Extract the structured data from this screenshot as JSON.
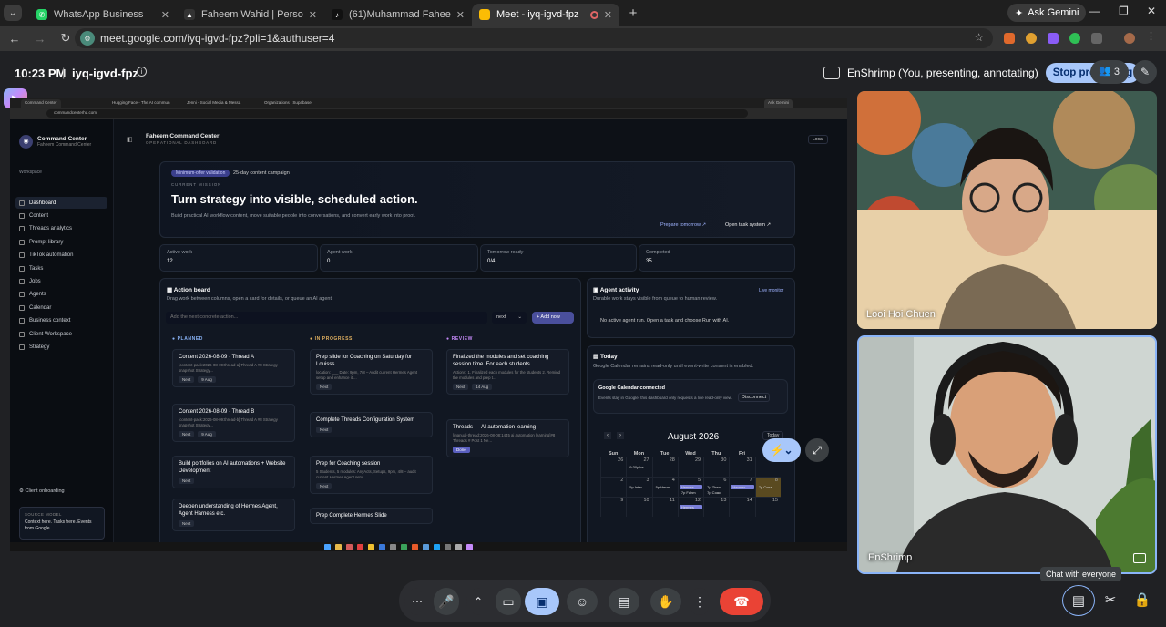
{
  "browser": {
    "tabs": [
      {
        "title": "WhatsApp Business",
        "icon": "whatsapp-icon",
        "color": "#25d366"
      },
      {
        "title": "Faheem Wahid | Personal link d",
        "icon": "threads-icon",
        "color": "#333333"
      },
      {
        "title": "(61)Muhammad Faheem (@_fa",
        "icon": "tiktok-icon",
        "color": "#111111"
      },
      {
        "title": "Meet - iyq-igvd-fpz",
        "icon": "meet-icon",
        "color": "#fbbc04"
      }
    ],
    "gemini_label": "Ask Gemini",
    "url": "meet.google.com/iyq-igvd-fpz?pli=1&authuser=4"
  },
  "meet": {
    "time": "10:23 PM",
    "code": "iyq-igvd-fpz",
    "presenting_label": "EnShrimp (You, presenting, annotating)",
    "stop_label": "Stop presenting",
    "people_count": "3",
    "tooltip": "Chat with everyone"
  },
  "shared": {
    "sh_tabs": [
      "Command Center",
      "Hugging Face - The AI commun",
      "Jenni - Social Media & Messa",
      "Organizations | Supabase"
    ],
    "sh_gemini": "Ask Gemini",
    "sh_url": "commandcenterhq.com",
    "brand_title": "Command Center",
    "brand_sub": "Faheem Command Center",
    "ws_label": "Workspace",
    "nav": [
      "Dashboard",
      "Content",
      "Threads analytics",
      "Prompt library",
      "TikTok automation",
      "Tasks",
      "Jobs",
      "Agents",
      "Calendar",
      "Business context",
      "Client Workspace",
      "Strategy"
    ],
    "onboarding": "Client onboarding",
    "share_title": "SOURCE MODEL",
    "share_text": "Context here. Tasks here. Events from Google.",
    "head_title": "Faheem Command Center",
    "head_sub": "OPERATIONAL DASHBOARD",
    "local": "Local",
    "hero": {
      "pill": "Minimum-offer validation",
      "pill2": "25-day content campaign",
      "mission": "CURRENT MISSION",
      "title": "Turn strategy into visible, scheduled action.",
      "desc": "Build practical AI workflow content, move suitable people into conversations, and convert early work into proof.",
      "link1": "Prepare tomorrow ↗",
      "link2": "Open task system ↗"
    },
    "stats": [
      {
        "label": "Active work",
        "value": "12"
      },
      {
        "label": "Agent work",
        "value": "0"
      },
      {
        "label": "Tomorrow ready",
        "value": "0/4"
      },
      {
        "label": "Completed",
        "value": "35"
      }
    ],
    "board": {
      "title": "Action board",
      "sub": "Drag work between columns, open a card for details, or queue an AI agent.",
      "placeholder": "Add the next concrete action...",
      "select": "next",
      "add": "+ Add now",
      "columns": [
        "PLANNED",
        "IN PROGRESS",
        "REVIEW"
      ],
      "planned": [
        {
          "t": "Content 2026-08-09 · Thread A",
          "d": "[content-pack:2026-08-09:thread-a] Thread A #8 Strategy snapshot Strategy...",
          "tags": [
            "Next",
            "9 Aug"
          ]
        },
        {
          "t": "Content 2026-08-09 · Thread B",
          "d": "[content-pack:2026-08-09:thread-b] Thread A #8 Strategy snapshot Strategy...",
          "tags": [
            "Next",
            "9 Aug"
          ]
        },
        {
          "t": "Build portfolios on AI automations + Website Development",
          "d": "",
          "tags": [
            "Next"
          ]
        },
        {
          "t": "Deepen understanding of Hermes Agent, Agent Harness etc.",
          "d": "",
          "tags": [
            "Next"
          ]
        }
      ],
      "progress": [
        {
          "t": "Prep slide for Coaching on Saturday for Louisss",
          "d": "location: ___ Date: 9pm, 7/8 – Audit current Hermes Agent setup and enhance it ...",
          "tags": [
            "Next"
          ]
        },
        {
          "t": "Complete Threads Configuration System",
          "d": "",
          "tags": [
            "Next"
          ]
        },
        {
          "t": "Prep for Coaching session",
          "d": "5 Students, 5 modules: AnyActs, Setups, 9pm, 4/8 – audit current Hermes Agent setu...",
          "tags": [
            "Next"
          ]
        },
        {
          "t": "Prep Complete Hermes Slide",
          "d": "",
          "tags": []
        }
      ],
      "review": [
        {
          "t": "Finalized the modules and set coaching session time. For each students.",
          "d": "Actions: 1. Finalized each modules for the students 2. Remind the modules and prep t...",
          "tags": [
            "Next",
            "14 Aug"
          ]
        },
        {
          "t": "Threads — AI automation learning",
          "d": "[manual-thread:2026-08-08:1445 ai automation learning]#8 Threads # Post 1 Ne...",
          "tags": [
            "Done"
          ]
        }
      ]
    },
    "agent": {
      "title": "Agent activity",
      "live": "Live monitor",
      "sub": "Durable work stays visible from queue to human review.",
      "empty": "No active agent run. Open a task and choose Run with AI."
    },
    "today": {
      "title": "Today",
      "sub": "Google Calendar remains read-only until event-write consent is enabled.",
      "conn": "Google Calendar connected",
      "conn_sub": "Events stay in Google; this dashboard only requests a live read-only view.",
      "disconnect": "Disconnect",
      "month": "August 2026",
      "today_btn": "Today",
      "dows": [
        "Sun",
        "Mon",
        "Tue",
        "Wed",
        "Thu",
        "Fri",
        "Sat"
      ],
      "weeks": [
        [
          "26",
          "27",
          "28",
          "29",
          "30",
          "31",
          "1"
        ],
        [
          "2",
          "3",
          "4",
          "5",
          "6",
          "7",
          "8"
        ],
        [
          "9",
          "10",
          "11",
          "12",
          "13",
          "14",
          "15"
        ]
      ],
      "events": [
        "9:30p ke",
        "5p Inter",
        "5p Herm",
        "Hermes",
        "7p Zhen",
        "Hermes",
        "7p Cosa",
        "7p Fahm",
        "7p Coac",
        "Hermes"
      ]
    }
  },
  "participants": [
    {
      "name": "Looi Hoi Chuen"
    },
    {
      "name": "EnShrimp"
    }
  ]
}
